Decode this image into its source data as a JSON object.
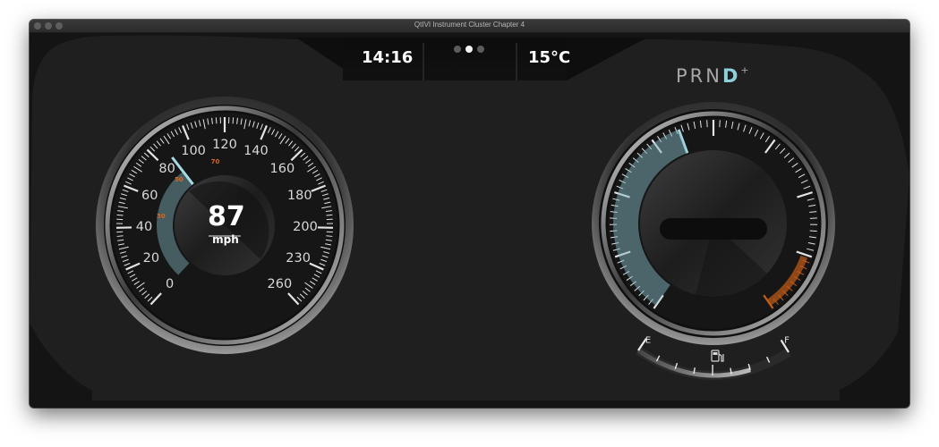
{
  "window": {
    "title": "QtIVI Instrument Cluster Chapter 4",
    "buttons": [
      "close",
      "minimize",
      "zoom"
    ]
  },
  "top_bar": {
    "time": "14:16",
    "temperature": "15°C",
    "pages": {
      "count": 3,
      "active_index": 1
    }
  },
  "speedometer": {
    "value": "87",
    "unit": "mph",
    "speed": 87,
    "tick_labels": [
      "0",
      "20",
      "40",
      "60",
      "80",
      "100",
      "120",
      "140",
      "160",
      "180",
      "200",
      "230",
      "260"
    ],
    "secondary_labels": [
      "30",
      "50",
      "70"
    ],
    "accent_color": "#7fb3bd",
    "secondary_color": "#d8661e"
  },
  "tachometer": {
    "fill_fraction": 0.43,
    "accent_color": "#7fb3bd",
    "redline_color": "#c55d1a"
  },
  "gear_selector": {
    "gears": [
      "P",
      "R",
      "N",
      "D"
    ],
    "active": "D",
    "modifier": "+"
  },
  "fuel_gauge": {
    "empty_label": "E",
    "full_label": "F",
    "level": 0.75,
    "icon": "fuel-pump-icon"
  },
  "icons": {
    "close": "traffic-light-close-icon",
    "minimize": "traffic-light-minimize-icon",
    "zoom": "traffic-light-zoom-icon"
  }
}
